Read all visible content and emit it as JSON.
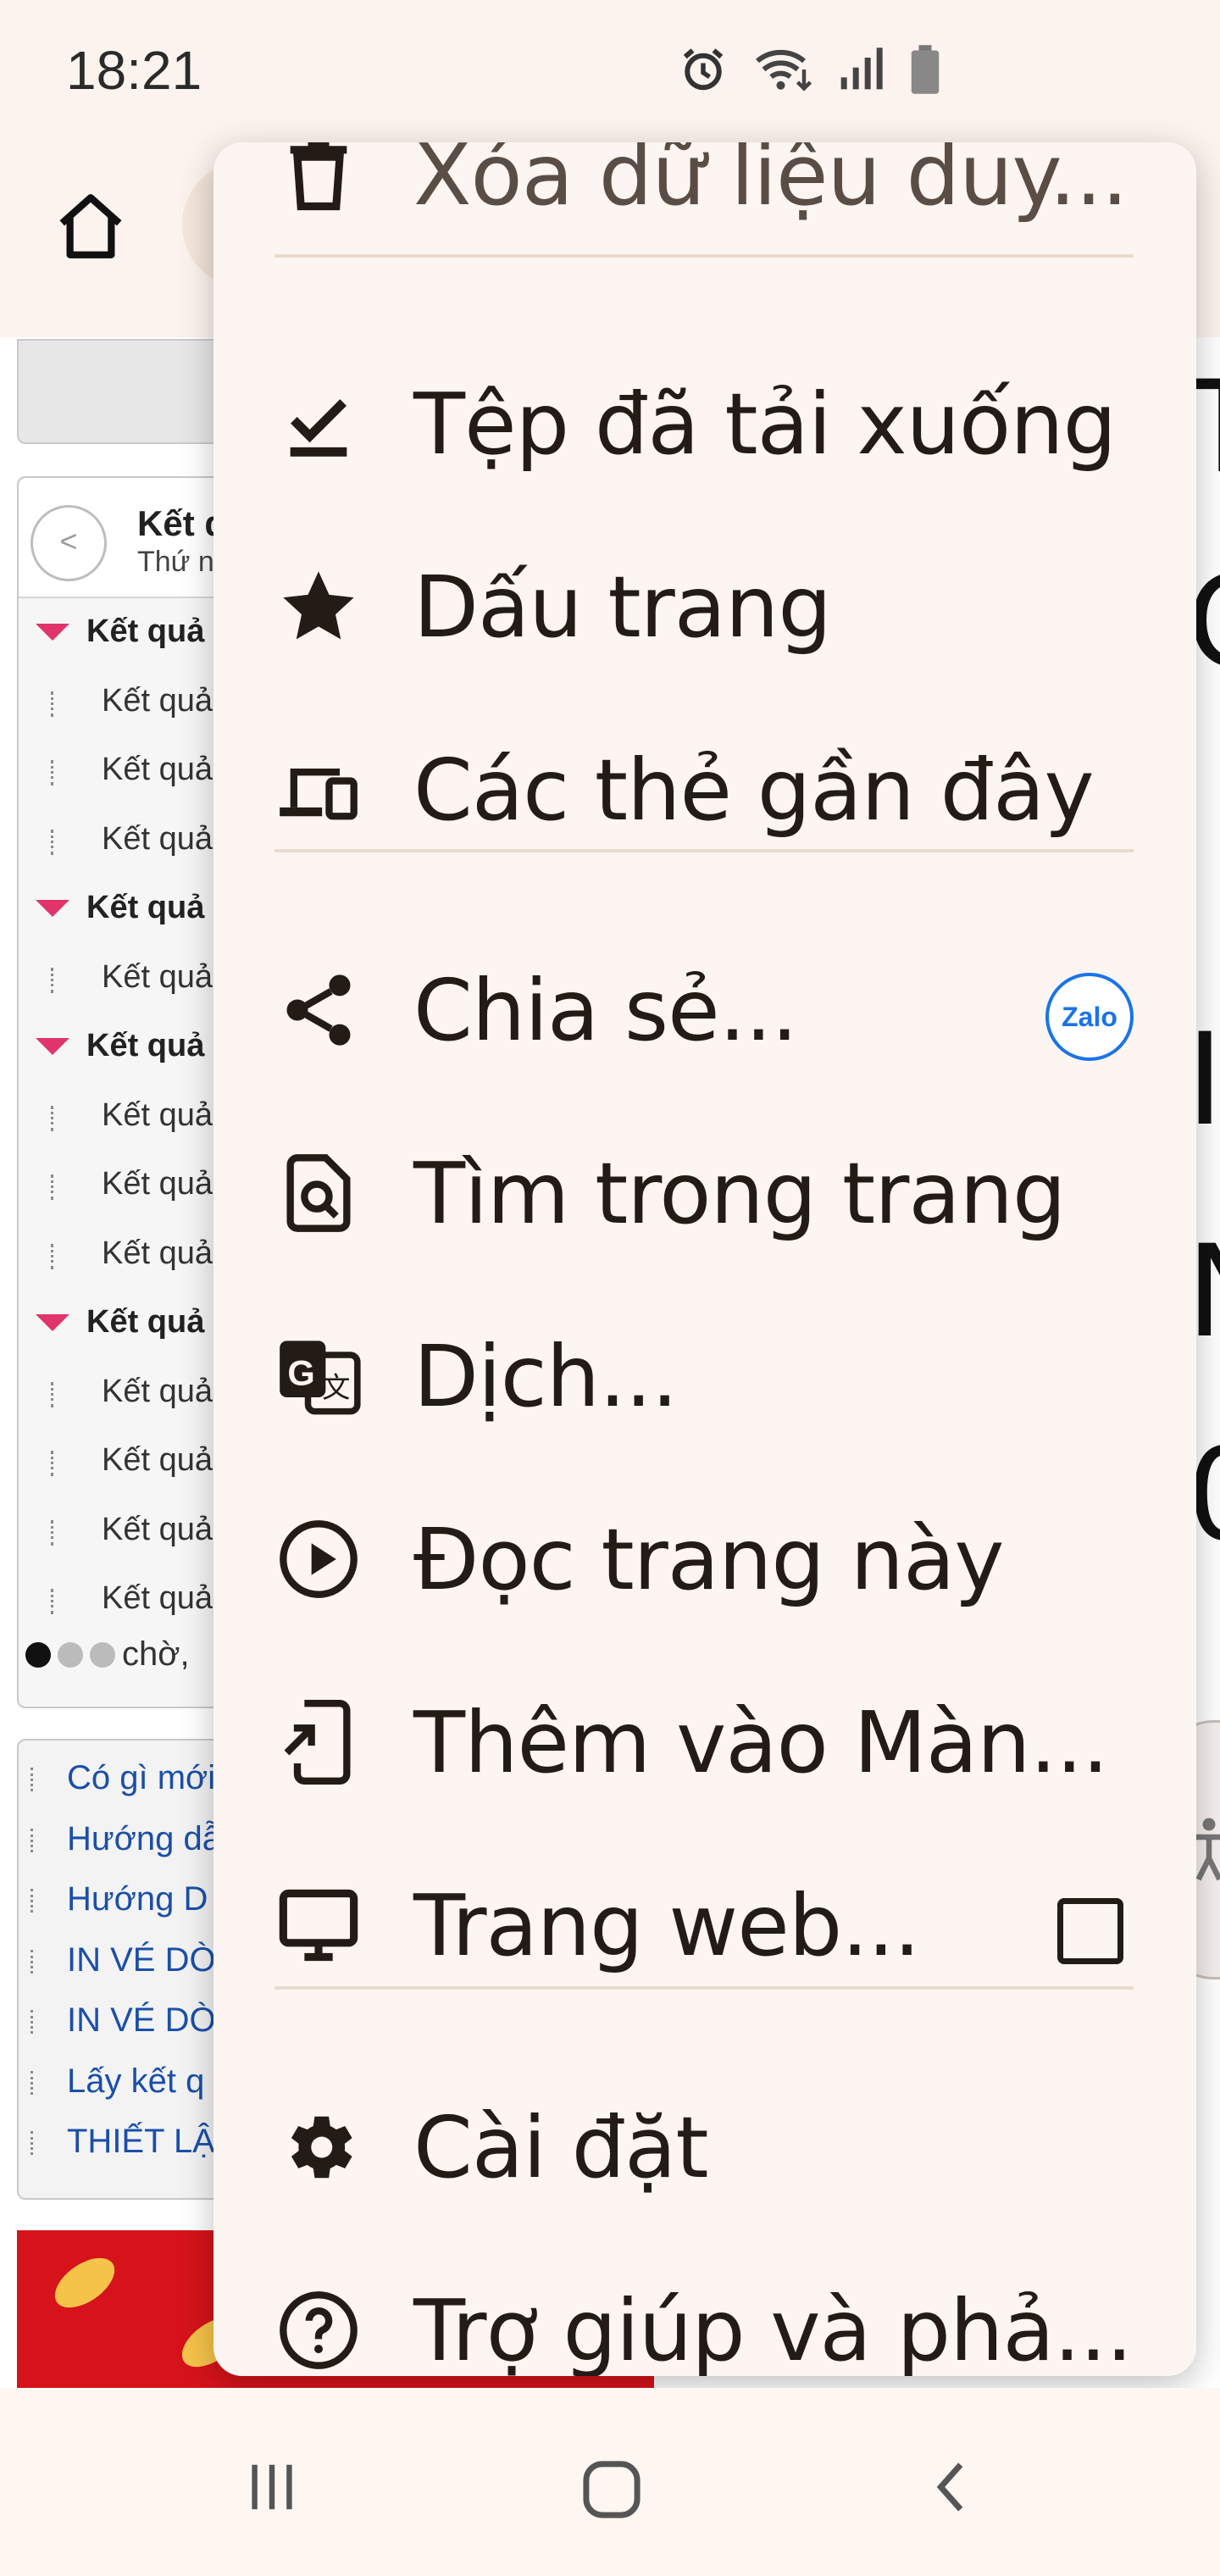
{
  "status_bar": {
    "time": "18:21",
    "icons": [
      "alarm-icon",
      "wifi-icon",
      "signal-icon",
      "battery-icon"
    ]
  },
  "toolbar": {
    "home_icon": "home-icon"
  },
  "background_page": {
    "side_title": "Kết q",
    "side_subtitle": "Thứ n",
    "back_label": "<",
    "tree_rows": [
      {
        "text": "Kết quả :",
        "bold": true
      },
      {
        "text": "Kết quả :",
        "bold": false
      },
      {
        "text": "Kết quả :",
        "bold": false
      },
      {
        "text": "Kết quả :",
        "bold": false
      },
      {
        "text": "Kết quả :",
        "bold": true
      },
      {
        "text": "Kết quả :",
        "bold": false
      },
      {
        "text": "Kết quả :",
        "bold": true
      },
      {
        "text": "Kết quả :",
        "bold": false
      },
      {
        "text": "Kết quả :",
        "bold": false
      },
      {
        "text": "Kết quả :",
        "bold": false
      },
      {
        "text": "Kết quả :",
        "bold": true
      },
      {
        "text": "Kết quả :",
        "bold": false
      },
      {
        "text": "Kết quả :",
        "bold": false
      },
      {
        "text": "Kết quả :",
        "bold": false
      },
      {
        "text": "Kết quả :",
        "bold": false
      }
    ],
    "waiting_text": "chờ,",
    "links": [
      "Có gì mới",
      "Hướng dẫ",
      "Hướng D",
      "IN VÉ DÒ",
      "IN VÉ DÒ",
      "Lấy kết q",
      "THIẾT LẬ"
    ]
  },
  "menu": {
    "top_partial": {
      "label": "Xóa dữ liệu duy...",
      "icon": "trash-icon"
    },
    "items": [
      {
        "label": "Tệp đã tải xuống",
        "icon": "download-done-icon"
      },
      {
        "label": "Dấu trang",
        "icon": "star-icon"
      },
      {
        "label": "Các thẻ gần đây",
        "icon": "devices-icon"
      },
      {
        "label": "Chia sẻ...",
        "icon": "share-icon",
        "badge": "Zalo"
      },
      {
        "label": "Tìm trong trang",
        "icon": "find-in-page-icon"
      },
      {
        "label": "Dịch...",
        "icon": "translate-icon"
      },
      {
        "label": "Đọc trang này",
        "icon": "play-circle-icon"
      },
      {
        "label": "Thêm vào Màn...",
        "icon": "add-to-home-icon"
      },
      {
        "label": "Trang web...",
        "icon": "desktop-icon",
        "checked": false
      },
      {
        "label": "Cài đặt",
        "icon": "gear-icon"
      },
      {
        "label": "Trợ giúp và phả...",
        "icon": "help-icon"
      }
    ]
  },
  "nav_bar": {
    "icons": [
      "recent-apps-icon",
      "home-nav-icon",
      "back-nav-icon"
    ]
  },
  "colors": {
    "menu_bg": "#fdf5f1",
    "text": "#231b16",
    "divider": "#eadbce",
    "zalo_blue": "#1b73e8",
    "tree_marker": "#e0346b",
    "link_blue": "#1b4fa8"
  }
}
